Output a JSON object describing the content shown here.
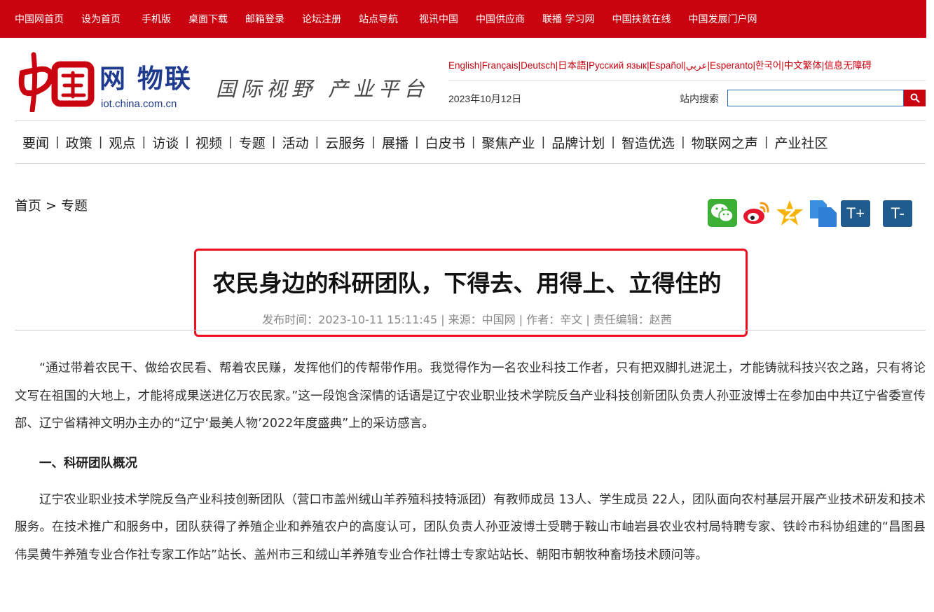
{
  "topbar": {
    "links": [
      "中国网首页",
      "设为首页",
      "手机版",
      "桌面下载",
      "邮箱登录",
      "论坛注册",
      "站点导航",
      "视讯中国",
      "中国供应商",
      "联播  学习网",
      "中国扶贫在线",
      "中国发展门户网"
    ]
  },
  "header": {
    "logo_name": "网 物联",
    "logo_domain": "iot.china.com.cn",
    "slogan": "国际视野 产业平台",
    "languages": [
      "English",
      "Français",
      "Deutsch",
      "日本語",
      "Русский язык",
      "Español",
      "عربي",
      "Esperanto",
      "한국어",
      "中文繁体",
      "信息无障碍"
    ],
    "date": "2023年10月12日",
    "search_label": "站内搜索",
    "search_value": ""
  },
  "nav": {
    "items": [
      "要闻",
      "政策",
      "观点",
      "访谈",
      "视频",
      "专题",
      "活动",
      "云服务",
      "展播",
      "白皮书",
      "聚焦产业",
      "品牌计划",
      "智造优选",
      "物联网之声",
      "产业社区"
    ]
  },
  "breadcrumb": {
    "home": "首页",
    "separator": " > ",
    "current": "专题"
  },
  "share": {
    "font_plus": "T+",
    "font_minus": "T-"
  },
  "article": {
    "title": "农民身边的科研团队，下得去、用得上、立得住的",
    "meta": "发布时间：2023-10-11 15:11:45 | 来源：中国网 | 作者：辛文 | 责任编辑：赵茜",
    "para1": "“通过带着农民干、做给农民看、帮着农民赚，发挥他们的传帮带作用。我觉得作为一名农业科技工作者，只有把双脚扎进泥土，才能铸就科技兴农之路，只有将论文写在祖国的大地上，才能将成果送进亿万农民家。”这一段饱含深情的话语是辽宁农业职业技术学院反刍产业科技创新团队负责人孙亚波博士在参加由中共辽宁省委宣传部、辽宁省精神文明办主办的“辽宁‘最美人物’2022年度盛典”上的采访感言。",
    "heading1": "一、科研团队概况",
    "para2": "辽宁农业职业技术学院反刍产业科技创新团队（营口市盖州绒山羊养殖科技特派团）有教师成员 13人、学生成员 22人，团队面向农村基层开展产业技术研发和技术服务。在技术推广和服务中，团队获得了养殖企业和养殖农户的高度认可，团队负责人孙亚波博士受聘于鞍山市岫岩县农业农村局特聘专家、铁岭市科协组建的“昌图县伟昊黄牛养殖专业合作社专家工作站”站长、盖州市三和绒山羊养殖专业合作社博士专家站站长、朝阳市朝牧种畜场技术顾问等。"
  },
  "colors": {
    "brand_red": "#c9030f",
    "highlight_red": "#f00e1f",
    "font_btn_blue": "#1f5b8c"
  }
}
